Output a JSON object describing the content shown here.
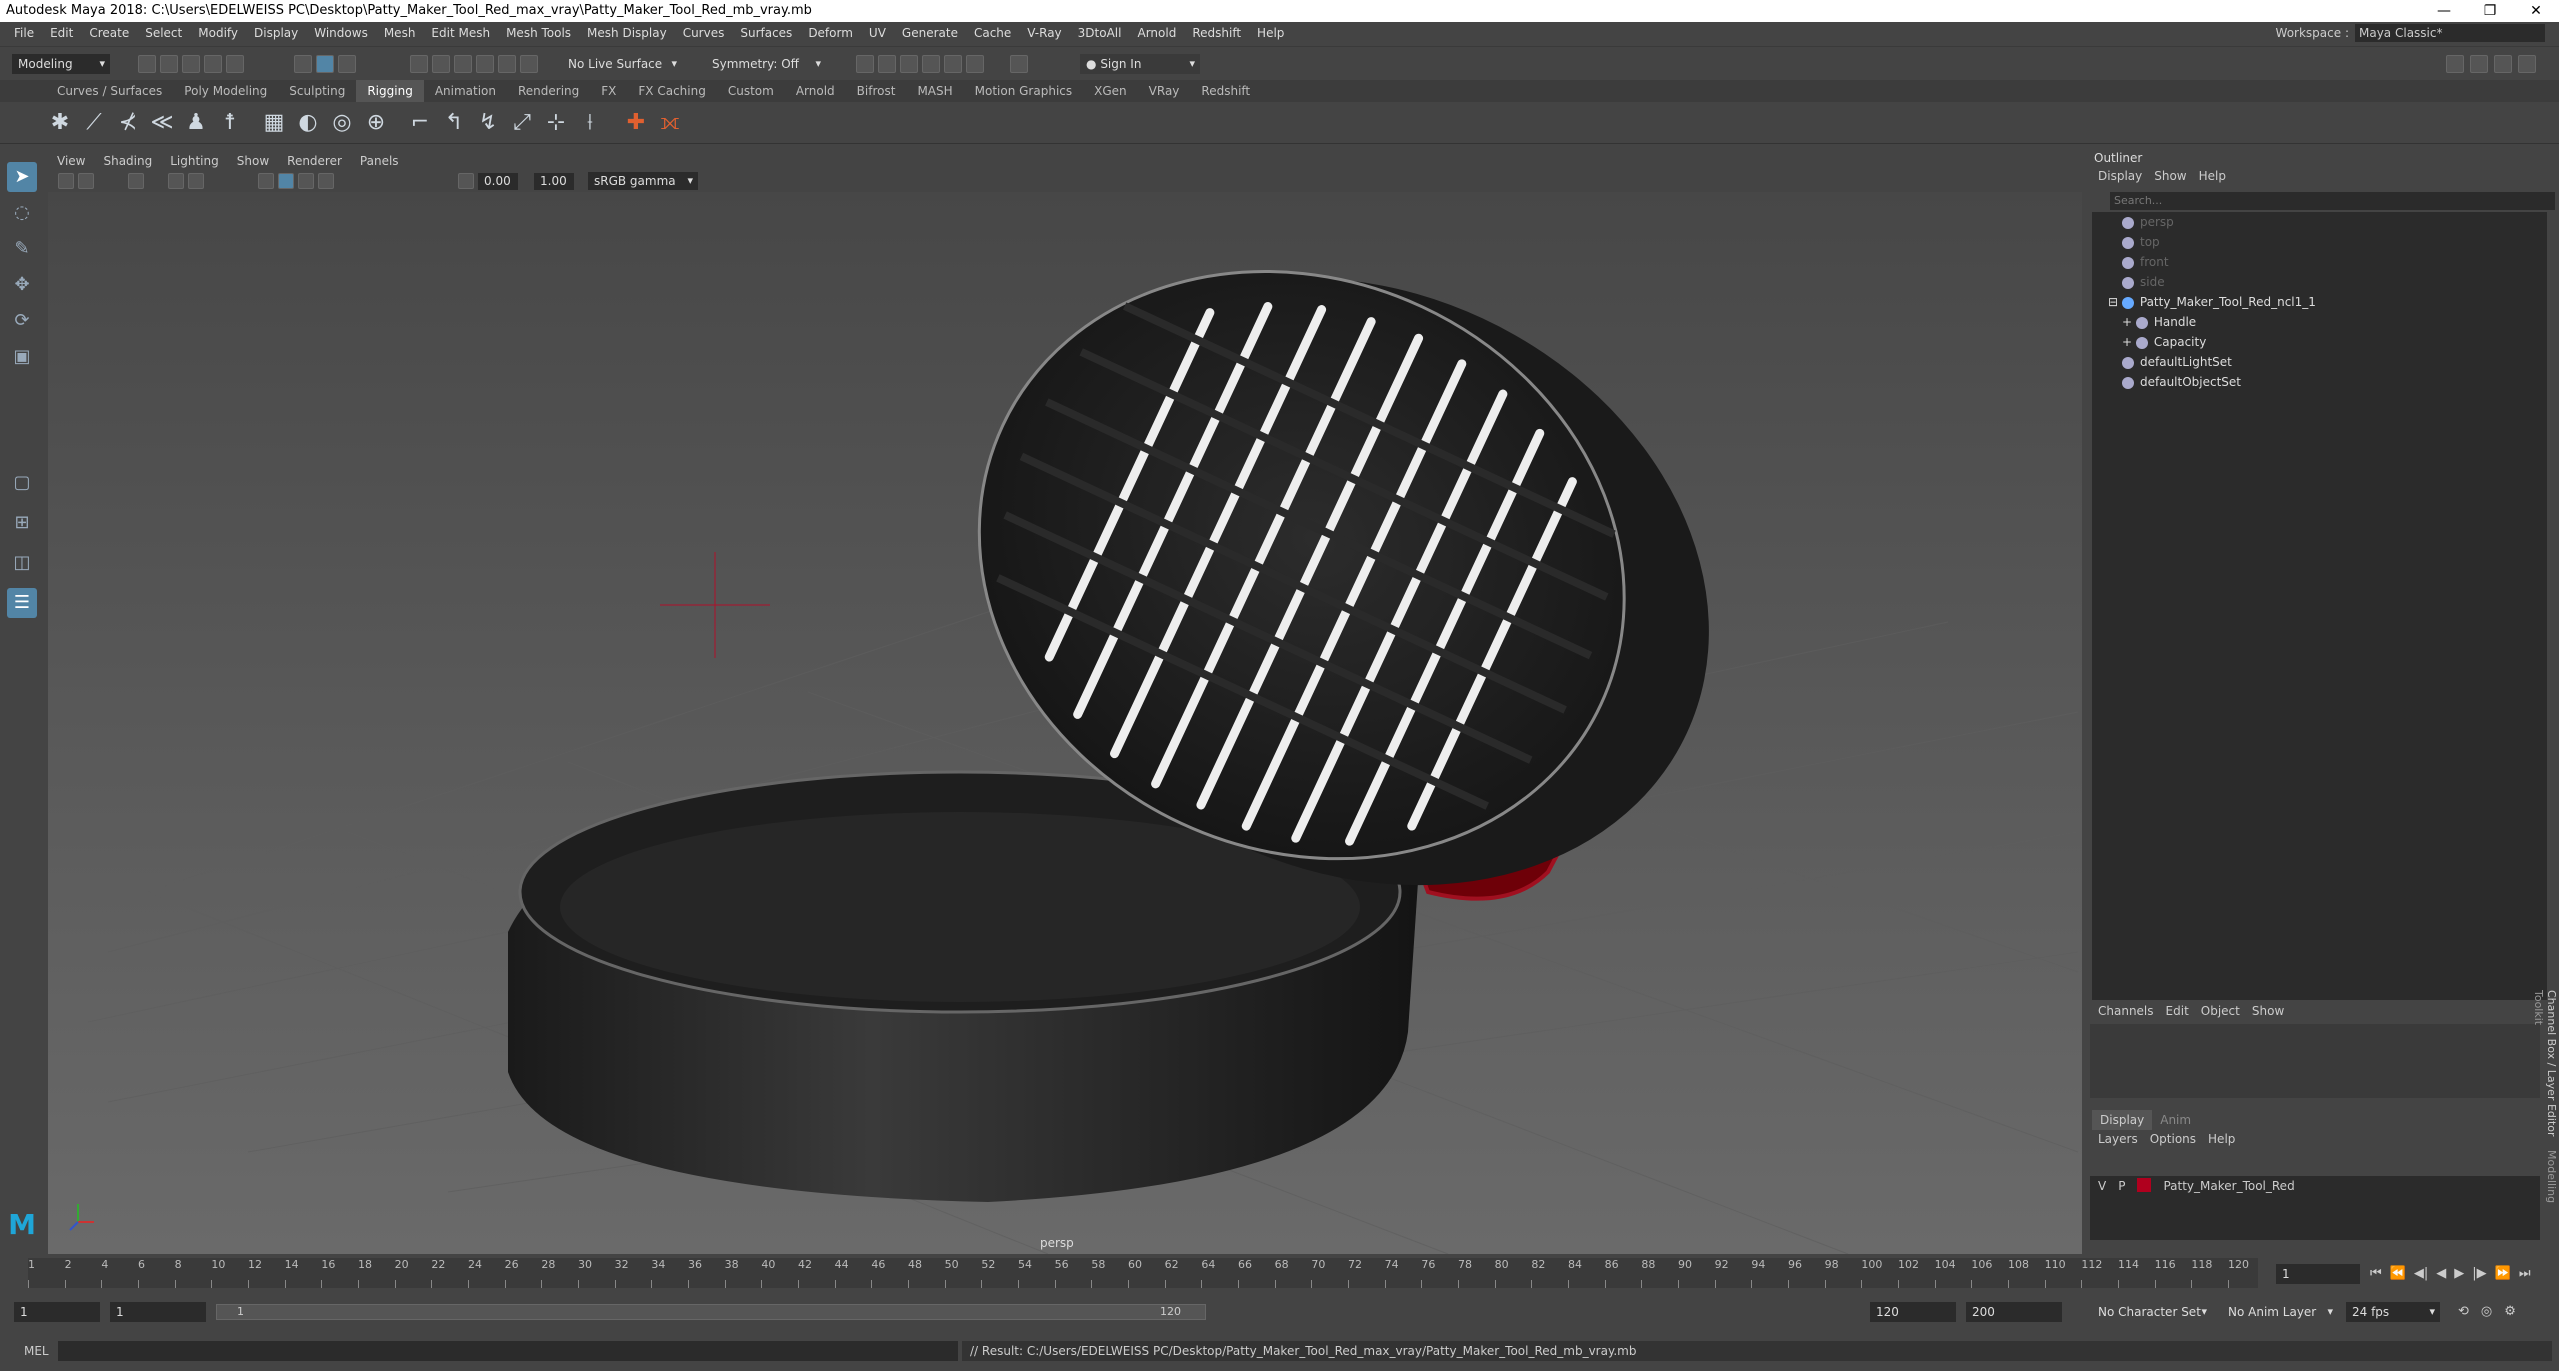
{
  "window": {
    "title": "Autodesk Maya 2018: C:\\Users\\EDELWEISS PC\\Desktop\\Patty_Maker_Tool_Red_max_vray\\Patty_Maker_Tool_Red_mb_vray.mb",
    "min": "—",
    "max": "❐",
    "close": "✕"
  },
  "menus": [
    "File",
    "Edit",
    "Create",
    "Select",
    "Modify",
    "Display",
    "Windows",
    "Mesh",
    "Edit Mesh",
    "Mesh Tools",
    "Mesh Display",
    "Curves",
    "Surfaces",
    "Deform",
    "UV",
    "Generate",
    "Cache",
    "V-Ray",
    "3DtoAll",
    "Arnold",
    "Redshift",
    "Help"
  ],
  "workspace": {
    "label": "Workspace :",
    "value": "Maya Classic*"
  },
  "status": {
    "mode": "Modeling",
    "live_surface": "No Live Surface",
    "symmetry": "Symmetry: Off",
    "sign_in": "Sign In"
  },
  "shelf_tabs": [
    "Curves / Surfaces",
    "Poly Modeling",
    "Sculpting",
    "Rigging",
    "Animation",
    "Rendering",
    "FX",
    "FX Caching",
    "Custom",
    "Arnold",
    "Bifrost",
    "MASH",
    "Motion Graphics",
    "XGen",
    "VRay",
    "Redshift"
  ],
  "active_shelf": "Rigging",
  "viewport": {
    "menus": [
      "View",
      "Shading",
      "Lighting",
      "Show",
      "Renderer",
      "Panels"
    ],
    "exposure": "0.00",
    "gamma": "1.00",
    "color_space": "sRGB gamma",
    "camera_label": "persp"
  },
  "outliner": {
    "title": "Outliner",
    "menus": [
      "Display",
      "Show",
      "Help"
    ],
    "search_placeholder": "Search...",
    "items": [
      "persp",
      "top",
      "front",
      "side",
      "Patty_Maker_Tool_Red_ncl1_1",
      "Handle",
      "Capacity",
      "defaultLightSet",
      "defaultObjectSet"
    ]
  },
  "channel_box": {
    "menus": [
      "Channels",
      "Edit",
      "Object",
      "Show"
    ]
  },
  "layer_editor": {
    "tabs": [
      "Display",
      "Anim"
    ],
    "menus": [
      "Layers",
      "Options",
      "Help"
    ],
    "layer": {
      "v": "V",
      "p": "P",
      "name": "Patty_Maker_Tool_Red",
      "color": "#b0001e"
    }
  },
  "side_tabs": [
    "Channel Box / Layer Editor",
    "Modelling Toolkit"
  ],
  "timeline": {
    "ticks": [
      "1",
      "2",
      "4",
      "6",
      "8",
      "10",
      "12",
      "14",
      "16",
      "18",
      "20",
      "22",
      "24",
      "26",
      "28",
      "30",
      "32",
      "34",
      "36",
      "38",
      "40",
      "42",
      "44",
      "46",
      "48",
      "50",
      "52",
      "54",
      "56",
      "58",
      "60",
      "62",
      "64",
      "66",
      "68",
      "70",
      "72",
      "74",
      "76",
      "78",
      "80",
      "82",
      "84",
      "86",
      "88",
      "90",
      "92",
      "94",
      "96",
      "98",
      "100",
      "102",
      "104",
      "106",
      "108",
      "110",
      "112",
      "114",
      "116",
      "118",
      "120"
    ],
    "current_frame": "1"
  },
  "range": {
    "start": "1",
    "start_inner": "1",
    "slider_start": "1",
    "slider_end": "120",
    "end_inner": "120",
    "end": "200",
    "char_set": "No Character Set",
    "anim_layer": "No Anim Layer",
    "fps": "24 fps"
  },
  "command": {
    "label": "MEL",
    "result": "// Result: C:/Users/EDELWEISS PC/Desktop/Patty_Maker_Tool_Red_max_vray/Patty_Maker_Tool_Red_mb_vray.mb"
  }
}
